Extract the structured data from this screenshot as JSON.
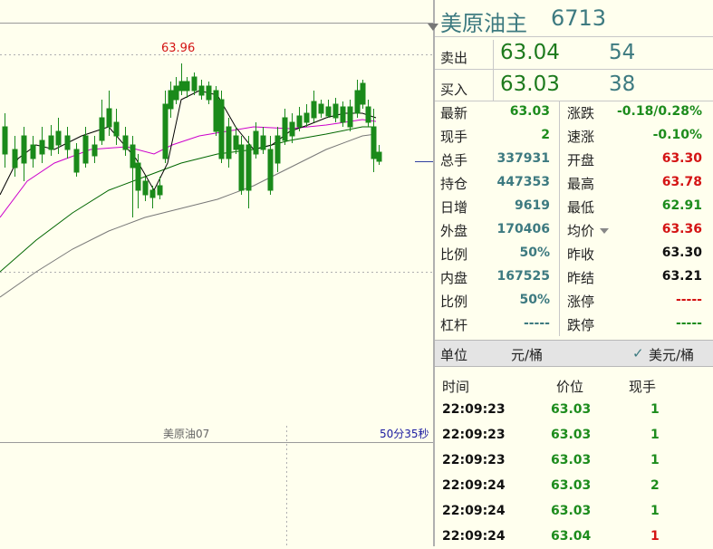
{
  "chart": {
    "high_label": "63.96",
    "contract_label": "美原油07",
    "time_label": "50分35秒"
  },
  "header": {
    "name": "美原油主",
    "code": "6713"
  },
  "quote": {
    "sell": {
      "label": "卖出",
      "price": "63.04",
      "volume": "54"
    },
    "buy": {
      "label": "买入",
      "price": "63.03",
      "volume": "38"
    }
  },
  "stats_left": [
    {
      "label": "最新",
      "value": "63.03",
      "color": "green"
    },
    {
      "label": "现手",
      "value": "2",
      "color": "green"
    },
    {
      "label": "总手",
      "value": "337931",
      "color": "teal"
    },
    {
      "label": "持仓",
      "value": "447353",
      "color": "teal"
    },
    {
      "label": "日增",
      "value": "9619",
      "color": "teal"
    },
    {
      "label": "外盘",
      "value": "170406",
      "color": "teal"
    },
    {
      "label": "比例",
      "value": "50%",
      "color": "teal"
    },
    {
      "label": "内盘",
      "value": "167525",
      "color": "teal"
    },
    {
      "label": "比例",
      "value": "50%",
      "color": "teal"
    },
    {
      "label": "杠杆",
      "value": "-----",
      "color": "teal"
    }
  ],
  "stats_right": [
    {
      "label": "涨跌",
      "value": "-0.18/0.28%",
      "color": "green"
    },
    {
      "label": "速涨",
      "value": "-0.10%",
      "color": "green"
    },
    {
      "label": "开盘",
      "value": "63.30",
      "color": "red"
    },
    {
      "label": "最高",
      "value": "63.78",
      "color": "red"
    },
    {
      "label": "最低",
      "value": "62.91",
      "color": "green"
    },
    {
      "label": "均价",
      "value": "63.36",
      "color": "red"
    },
    {
      "label": "昨收",
      "value": "63.30",
      "color": "black"
    },
    {
      "label": "昨结",
      "value": "63.21",
      "color": "black"
    },
    {
      "label": "涨停",
      "value": "-----",
      "color": "red"
    },
    {
      "label": "跌停",
      "value": "-----",
      "color": "green"
    }
  ],
  "unit": {
    "label": "单位",
    "cny": "元/桶",
    "check": "✓",
    "usd": "美元/桶"
  },
  "ticks": {
    "headers": {
      "time": "时间",
      "price": "价位",
      "qty": "现手"
    },
    "rows": [
      {
        "time": "22:09:23",
        "price": "63.03",
        "qty": "1",
        "qty_color": "green"
      },
      {
        "time": "22:09:23",
        "price": "63.03",
        "qty": "1",
        "qty_color": "green"
      },
      {
        "time": "22:09:23",
        "price": "63.03",
        "qty": "1",
        "qty_color": "green"
      },
      {
        "time": "22:09:24",
        "price": "63.03",
        "qty": "2",
        "qty_color": "green"
      },
      {
        "time": "22:09:24",
        "price": "63.03",
        "qty": "1",
        "qty_color": "green"
      },
      {
        "time": "22:09:24",
        "price": "63.04",
        "qty": "1",
        "qty_color": "red"
      }
    ]
  },
  "colors": {
    "green": "#1d8c1d",
    "red": "#d41414",
    "teal": "#3d7a80",
    "black": "#111111",
    "candle_up": "#e02020",
    "candle_down": "#1a8a1a",
    "ma_short": "#000000",
    "ma_mid": "#cc00cc",
    "ma_long": "#006600",
    "ma_slow": "#777777"
  }
}
